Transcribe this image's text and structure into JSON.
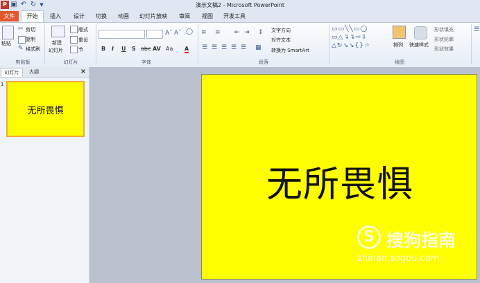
{
  "window": {
    "title": "演示文稿2 - Microsoft PowerPoint"
  },
  "qat": {
    "icons": [
      "save-icon",
      "undo-icon",
      "redo-icon",
      "customize-icon"
    ]
  },
  "tabs": [
    "文件",
    "开始",
    "插入",
    "设计",
    "切换",
    "动画",
    "幻灯片放映",
    "审阅",
    "视图",
    "开发工具"
  ],
  "ribbon": {
    "clipboard": {
      "paste": "粘贴",
      "cut": "剪切",
      "copy": "复制",
      "format_painter": "格式刷",
      "label": "剪贴板"
    },
    "slides": {
      "new_slide_1": "新建",
      "new_slide_2": "幻灯片",
      "layout": "版式",
      "reset": "重设",
      "section": "节",
      "label": "幻灯片"
    },
    "font": {
      "format_buttons": [
        "B",
        "I",
        "U",
        "S",
        "abc",
        "AV",
        "Aa",
        "A"
      ],
      "label": "字体"
    },
    "paragraph": {
      "text_direction": "文字方向",
      "align_text": "对齐文本",
      "smartart": "转换为 SmartArt",
      "label": "段落"
    },
    "drawing": {
      "arrange": "排列",
      "quick_styles": "快速样式",
      "shape_fill": "形状填充",
      "shape_outline": "形状轮廓",
      "shape_effects": "形状效果",
      "label": "绘图"
    }
  },
  "left_panel": {
    "tabs": [
      "幻灯片",
      "大纲"
    ],
    "close": "×"
  },
  "thumbnail": {
    "number": "1",
    "text": "无所畏惧"
  },
  "slide": {
    "title": "无所畏惧",
    "background_color": "#ffff00"
  },
  "watermark": {
    "name": "搜狗指南",
    "url": "zhinan.sogou.com",
    "logo": "S"
  }
}
